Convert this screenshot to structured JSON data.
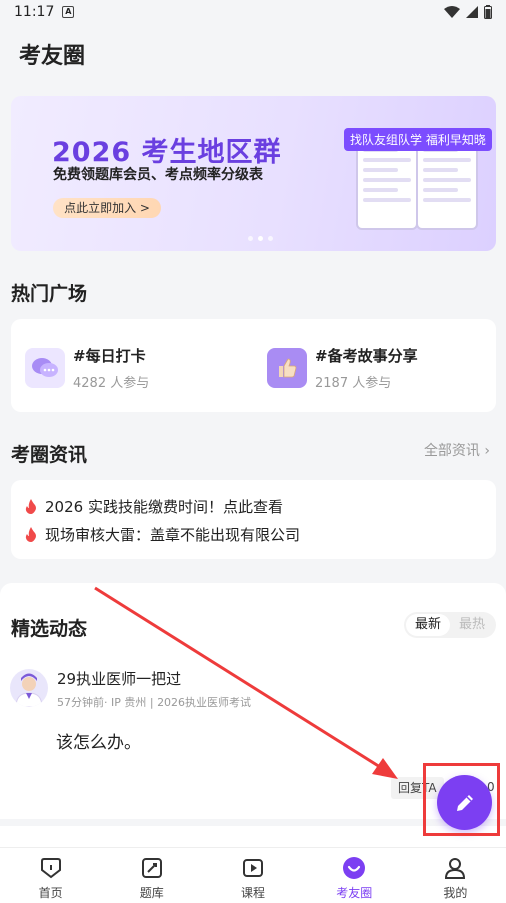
{
  "status_bar": {
    "time": "11:17"
  },
  "header": {
    "title": "考友圈"
  },
  "banner": {
    "title": "2026 考生地区群",
    "subtitle": "免费领题库会员、考点频率分级表",
    "button": "点此立即加入 >",
    "tag": "找队友组队学 福利早知晓"
  },
  "hot": {
    "title": "热门广场",
    "items": [
      {
        "name": "#每日打卡",
        "count": "4282 人参与"
      },
      {
        "name": "#备考故事分享",
        "count": "2187 人参与"
      }
    ]
  },
  "news": {
    "title": "考圈资讯",
    "more": "全部资讯",
    "items": [
      "2026 实践技能缴费时间！点此查看",
      "现场审核大雷：盖章不能出现有限公司"
    ]
  },
  "feed": {
    "title": "精选动态",
    "toggle": {
      "latest": "最新",
      "hottest": "最热"
    },
    "post": {
      "user": "29执业医师一把过",
      "meta": "57分钟前· IP 贵州 | 2026执业医师考试",
      "text": "该怎么办。",
      "reply": "回复TA",
      "reply_count": "0"
    }
  },
  "tabs": [
    {
      "label": "首页",
      "icon": "home-icon"
    },
    {
      "label": "题库",
      "icon": "question-bank-icon"
    },
    {
      "label": "课程",
      "icon": "video-play-icon"
    },
    {
      "label": "考友圈",
      "icon": "smile-circle-icon"
    },
    {
      "label": "我的",
      "icon": "user-icon"
    }
  ],
  "colors": {
    "accent": "#7c3ff2",
    "highlight": "#ee3b3b",
    "fire": "#f04a4a"
  }
}
